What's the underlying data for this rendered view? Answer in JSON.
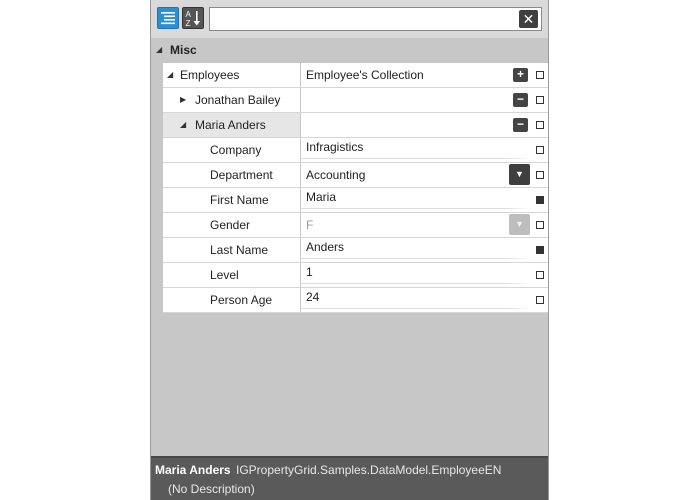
{
  "toolbar": {
    "categorized_icon": "categorized-list-icon",
    "alphabetical_icon": "sort-az-icon",
    "alpha_glyph_top": "A",
    "alpha_glyph_bottom": "Z",
    "search_value": "",
    "clear_glyph": "✕"
  },
  "category": {
    "label": "Misc",
    "glyph": "◢"
  },
  "rows": [
    {
      "name": "Employees",
      "value": "Employee's Collection",
      "glyph": "◢",
      "button": "+",
      "checked": false
    },
    {
      "name": "Jonathan Bailey",
      "value": "",
      "glyph": "▶",
      "button": "−",
      "checked": false
    },
    {
      "name": "Maria Anders",
      "value": "",
      "glyph": "◢",
      "button": "−",
      "checked": false
    },
    {
      "name": "Company",
      "value": "Infragistics",
      "checked": false
    },
    {
      "name": "Department",
      "value": "Accounting",
      "dropdown": "▼",
      "checked": false
    },
    {
      "name": "First Name",
      "value": "Maria",
      "checked": true
    },
    {
      "name": "Gender",
      "value": "F",
      "dropdown": "▼",
      "checked": false
    },
    {
      "name": "Last Name",
      "value": "Anders",
      "checked": true
    },
    {
      "name": "Level",
      "value": "1",
      "checked": false
    },
    {
      "name": "Person Age",
      "value": "24",
      "checked": false
    }
  ],
  "description": {
    "title": "Maria Anders",
    "type": "IGPropertyGrid.Samples.DataModel.EmployeeEN",
    "text": "(No Description)"
  },
  "colors": {
    "accent": "#2b8fd6",
    "panel": "#c8c8c8",
    "footer": "#5a5a5a"
  }
}
